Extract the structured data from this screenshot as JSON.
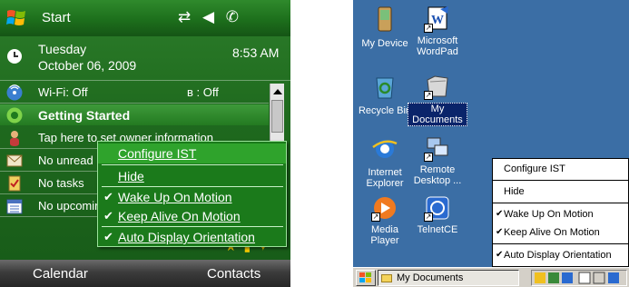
{
  "wm": {
    "start_label": "Start",
    "status_icons": "⇄ ◀ ✆",
    "date_line1": "Tuesday",
    "date_line2": "October 06, 2009",
    "time": "8:53 AM",
    "wifi": "Wi-Fi: Off",
    "bluetooth": "ʙ : Off",
    "items": [
      {
        "label": "Getting Started"
      },
      {
        "label": "Tap here to set owner information"
      },
      {
        "label": "No unread messages"
      },
      {
        "label": "No tasks"
      },
      {
        "label": "No upcoming appointments"
      }
    ],
    "menu": {
      "configure": "Configure IST",
      "hide": "Hide",
      "wake": "Wake Up On Motion",
      "keep": "Keep Alive On Motion",
      "auto": "Auto Display Orientation",
      "check": "✔"
    },
    "softkeys": {
      "left": "Calendar",
      "right": "Contacts"
    }
  },
  "ce": {
    "icons": {
      "my_device": "My Device",
      "wordpad": "Microsoft WordPad",
      "recycle": "Recycle Bin",
      "my_documents": "My Documents",
      "ie": "Internet Explorer",
      "remote": "Remote Desktop ...",
      "media": "Media Player",
      "telnet": "TelnetCE"
    },
    "menu": {
      "configure": "Configure IST",
      "hide": "Hide",
      "wake": "Wake Up On Motion",
      "keep": "Keep Alive On Motion",
      "auto": "Auto Display Orientation",
      "check": "✔"
    },
    "taskbar": {
      "button": "My Documents"
    }
  }
}
